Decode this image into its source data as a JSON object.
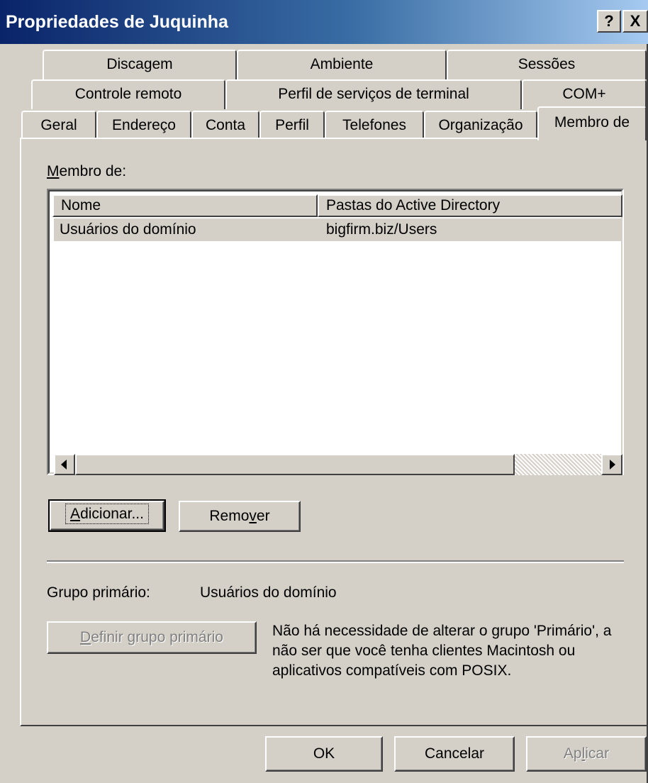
{
  "window": {
    "title": "Propriedades de Juquinha",
    "help_button": "?",
    "close_button": "X"
  },
  "tabs": {
    "row1": [
      "Discagem",
      "Ambiente",
      "Sessões"
    ],
    "row2": [
      "Controle remoto",
      "Perfil de serviços de terminal",
      "COM+"
    ],
    "row3": [
      "Geral",
      "Endereço",
      "Conta",
      "Perfil",
      "Telefones",
      "Organização",
      "Membro de"
    ],
    "selected": "Membro de"
  },
  "member_of": {
    "label": "Membro de:",
    "label_accesskey": "M",
    "label_rest": "embro de:",
    "columns": [
      "Nome",
      "Pastas do Active Directory"
    ],
    "rows": [
      {
        "name": "Usuários do domínio",
        "folder": "bigfirm.biz/Users"
      }
    ]
  },
  "buttons": {
    "add": {
      "label": "Adicionar...",
      "accesskey": "A",
      "rest": "dicionar..."
    },
    "remove": {
      "label": "Remover",
      "pre": "Remo",
      "accesskey": "v",
      "post": "er"
    },
    "set_primary": {
      "label": "Definir grupo primário",
      "pre": "",
      "accesskey": "D",
      "post": "efinir grupo primário"
    },
    "ok": "OK",
    "cancel": "Cancelar",
    "apply": {
      "label": "Aplicar",
      "pre": "Ap",
      "accesskey": "l",
      "post": "icar"
    }
  },
  "primary_group": {
    "label": "Grupo primário:",
    "value": "Usuários do domínio",
    "description": "Não há necessidade de alterar o grupo 'Primário', a não ser que você tenha clientes Macintosh ou aplicativos compatíveis com POSIX."
  }
}
